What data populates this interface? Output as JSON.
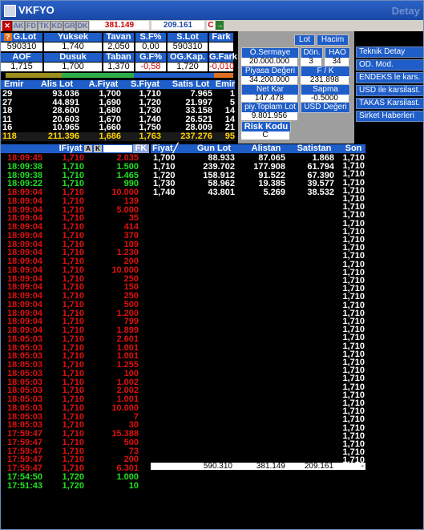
{
  "window": {
    "title": "VKFYO",
    "ghost_title": "Detay"
  },
  "tabs": [
    "AK",
    "FD",
    "TK",
    "KD",
    "GR",
    "DK"
  ],
  "top_values": {
    "v1": "381.149",
    "v2": "209.161",
    "c": "C",
    "arrow": "→"
  },
  "summary": {
    "row1_headers": [
      "G.Lot",
      "Yuksek",
      "Tavan",
      "S.F%",
      "S.Lot",
      "Fark"
    ],
    "row1_values": [
      "590310",
      "1,740",
      "2,050",
      "0,00",
      "590310",
      ""
    ],
    "row2_headers": [
      "AOF",
      "Dusuk",
      "Taban",
      "G.F%",
      "OG.Kap.",
      "G.Fark"
    ],
    "row2_values": [
      "1,715",
      "1,700",
      "1,370",
      "-0,58",
      "1,720",
      "-0,010"
    ]
  },
  "right_panel": {
    "lot_btn": "Lot",
    "hacim_btn": "Hacim",
    "osermaye_label": "Ö.Sermaye",
    "osermaye_value": "20.000.000",
    "don_label": "Dön.",
    "don_value": "3",
    "hao_label": "HAO",
    "hao_value": "34",
    "piyasa_label": "Piyasa Değeri",
    "piyasa_value": "34.200.000",
    "fk_label": "F / K",
    "fk_value": "231.898",
    "netkar_label": "Net Kar",
    "netkar_value": "147.478",
    "sapma_label": "Sapma",
    "sapma_value": "-0.5000",
    "piytoplam_label": "piy.Toplam Lot",
    "piytoplam_value": "9.801.956",
    "usd_label": "USD Değeri",
    "risk_label": "Risk Kodu",
    "risk_value": "C"
  },
  "side_buttons": [
    "Teknik Detay",
    "OD. Mod.",
    "ENDEKS le kars.",
    "USD ile karsilast.",
    "TAKAS Karsilast.",
    "Sirket Haberleri"
  ],
  "depth": {
    "headers": [
      "Emir",
      "Alis Lot",
      "A.Fiyat",
      "S.Fiyat",
      "Satis Lot",
      "Emir"
    ],
    "rows": [
      [
        "29",
        "93.036",
        "1,700",
        "1,710",
        "7.965",
        "1"
      ],
      [
        "27",
        "44.891",
        "1,690",
        "1,720",
        "21.997",
        "5"
      ],
      [
        "18",
        "28.600",
        "1,680",
        "1,730",
        "33.158",
        "14"
      ],
      [
        "11",
        "20.603",
        "1,670",
        "1,740",
        "26.521",
        "14"
      ],
      [
        "16",
        "10.965",
        "1,660",
        "1,750",
        "28.009",
        "21"
      ]
    ],
    "total": [
      "118",
      "211.396",
      "1,686",
      "1,763",
      "237.276",
      "95"
    ]
  },
  "trades": {
    "headers": {
      "saat": "",
      "fiyat": "IFiyat",
      "a": "A",
      "k": "K",
      "lot": "",
      "fk": "FK"
    },
    "rows": [
      {
        "t": "18:09:45",
        "p": "1,710",
        "l": "2.035",
        "c": "red"
      },
      {
        "t": "18:09:38",
        "p": "1,710",
        "l": "1.500",
        "c": "green"
      },
      {
        "t": "18:09:38",
        "p": "1,710",
        "l": "1.465",
        "c": "green"
      },
      {
        "t": "18:09:22",
        "p": "1,710",
        "l": "990",
        "c": "green"
      },
      {
        "t": "18:09:04",
        "p": "1,710",
        "l": "10.000",
        "c": "red"
      },
      {
        "t": "18:09:04",
        "p": "1,710",
        "l": "139",
        "c": "red"
      },
      {
        "t": "18:09:04",
        "p": "1,710",
        "l": "5.000",
        "c": "red"
      },
      {
        "t": "18:09:04",
        "p": "1,710",
        "l": "35",
        "c": "red"
      },
      {
        "t": "18:09:04",
        "p": "1,710",
        "l": "414",
        "c": "red"
      },
      {
        "t": "18:09:04",
        "p": "1,710",
        "l": "370",
        "c": "red"
      },
      {
        "t": "18:09:04",
        "p": "1,710",
        "l": "109",
        "c": "red"
      },
      {
        "t": "18:09:04",
        "p": "1,710",
        "l": "1.230",
        "c": "red"
      },
      {
        "t": "18:09:04",
        "p": "1,710",
        "l": "200",
        "c": "red"
      },
      {
        "t": "18:09:04",
        "p": "1,710",
        "l": "10.000",
        "c": "red"
      },
      {
        "t": "18:09:04",
        "p": "1,710",
        "l": "250",
        "c": "red"
      },
      {
        "t": "18:09:04",
        "p": "1,710",
        "l": "150",
        "c": "red"
      },
      {
        "t": "18:09:04",
        "p": "1,710",
        "l": "250",
        "c": "red"
      },
      {
        "t": "18:09:04",
        "p": "1,710",
        "l": "500",
        "c": "red"
      },
      {
        "t": "18:09:04",
        "p": "1,710",
        "l": "1.200",
        "c": "red"
      },
      {
        "t": "18:09:04",
        "p": "1,710",
        "l": "799",
        "c": "red"
      },
      {
        "t": "18:09:04",
        "p": "1,710",
        "l": "1.899",
        "c": "red"
      },
      {
        "t": "18:05:03",
        "p": "1,710",
        "l": "2.601",
        "c": "red"
      },
      {
        "t": "18:05:03",
        "p": "1,710",
        "l": "1.001",
        "c": "red"
      },
      {
        "t": "18:05:03",
        "p": "1,710",
        "l": "1.001",
        "c": "red"
      },
      {
        "t": "18:05:03",
        "p": "1,710",
        "l": "1.255",
        "c": "red"
      },
      {
        "t": "18:05:03",
        "p": "1,710",
        "l": "100",
        "c": "red"
      },
      {
        "t": "18:05:03",
        "p": "1,710",
        "l": "1.002",
        "c": "red"
      },
      {
        "t": "18:05:03",
        "p": "1,710",
        "l": "2.002",
        "c": "red"
      },
      {
        "t": "18:05:03",
        "p": "1,710",
        "l": "1.001",
        "c": "red"
      },
      {
        "t": "18:05:03",
        "p": "1,710",
        "l": "10.000",
        "c": "red"
      },
      {
        "t": "18:05:03",
        "p": "1,710",
        "l": "7",
        "c": "red"
      },
      {
        "t": "18:05:03",
        "p": "1,710",
        "l": "30",
        "c": "red"
      },
      {
        "t": "17:59:47",
        "p": "1,710",
        "l": "15.388",
        "c": "red"
      },
      {
        "t": "17:59:47",
        "p": "1,710",
        "l": "500",
        "c": "red"
      },
      {
        "t": "17:59:47",
        "p": "1,710",
        "l": "73",
        "c": "red"
      },
      {
        "t": "17:59:47",
        "p": "1,710",
        "l": "200",
        "c": "red"
      },
      {
        "t": "17:59:47",
        "p": "1,710",
        "l": "6.301",
        "c": "red"
      },
      {
        "t": "17:54:50",
        "p": "1,720",
        "l": "1.000",
        "c": "green"
      },
      {
        "t": "17:51:43",
        "p": "1,720",
        "l": "10",
        "c": "green"
      }
    ]
  },
  "volume": {
    "headers": [
      "Fiyat",
      "Gun Lot",
      "Alistan",
      "Satistan",
      "Son"
    ],
    "rows": [
      [
        "1,700",
        "88.933",
        "87.065",
        "1.868"
      ],
      [
        "1,710",
        "239.702",
        "177.908",
        "61.794"
      ],
      [
        "1,720",
        "158.912",
        "91.522",
        "67.390"
      ],
      [
        "1,730",
        "58.962",
        "19.385",
        "39.577"
      ],
      [
        "1,740",
        "43.801",
        "5.269",
        "38.532"
      ]
    ],
    "son_values": [
      "1,710",
      "1,710",
      "1,710",
      "1,710",
      "1,710",
      "1,710",
      "1,710",
      "1,710",
      "1,710",
      "1,710",
      "1,710",
      "1,710",
      "1,710",
      "1,710",
      "1,710",
      "1,710",
      "1,710",
      "1,710",
      "1,710",
      "1,710",
      "1,710",
      "1,710",
      "1,710",
      "1,710",
      "1,710",
      "1,710",
      "1,710",
      "1,710",
      "1,710",
      "1,710",
      "1,710",
      "1,710",
      "1,710",
      "1,710",
      "1,710",
      "1,710",
      "1,710",
      "1,710"
    ],
    "totals": [
      "590.310",
      "381.149",
      "209.161",
      "-"
    ]
  }
}
